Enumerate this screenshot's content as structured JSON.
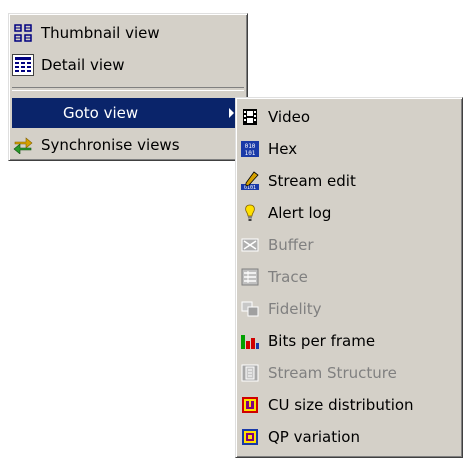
{
  "main_menu": {
    "items": [
      {
        "label": "Thumbnail view",
        "icon": "thumbnail-grid-icon"
      },
      {
        "label": "Detail view",
        "icon": "detail-list-icon"
      },
      {
        "label": "Goto view",
        "icon": "",
        "selected": true,
        "has_submenu": true
      },
      {
        "label": "Synchronise views",
        "icon": "synchronise-arrows-icon"
      }
    ]
  },
  "submenu": {
    "items": [
      {
        "label": "Video",
        "icon": "film-icon",
        "enabled": true
      },
      {
        "label": "Hex",
        "icon": "hex-grid-icon",
        "enabled": true
      },
      {
        "label": "Stream edit",
        "icon": "pencil-binary-icon",
        "enabled": true
      },
      {
        "label": "Alert log",
        "icon": "alert-bulb-icon",
        "enabled": true
      },
      {
        "label": "Buffer",
        "icon": "buffer-icon",
        "enabled": false
      },
      {
        "label": "Trace",
        "icon": "trace-list-icon",
        "enabled": false
      },
      {
        "label": "Fidelity",
        "icon": "fidelity-icon",
        "enabled": false
      },
      {
        "label": "Bits per frame",
        "icon": "bar-chart-icon",
        "enabled": true
      },
      {
        "label": "Stream Structure",
        "icon": "stream-structure-icon",
        "enabled": false
      },
      {
        "label": "CU size distribution",
        "icon": "cu-size-icon",
        "enabled": true
      },
      {
        "label": "QP variation",
        "icon": "qp-variation-icon",
        "enabled": true
      }
    ]
  },
  "colors": {
    "menu_bg": "#d4d0c8",
    "highlight": "#0a246a",
    "disabled_text": "#808080"
  }
}
